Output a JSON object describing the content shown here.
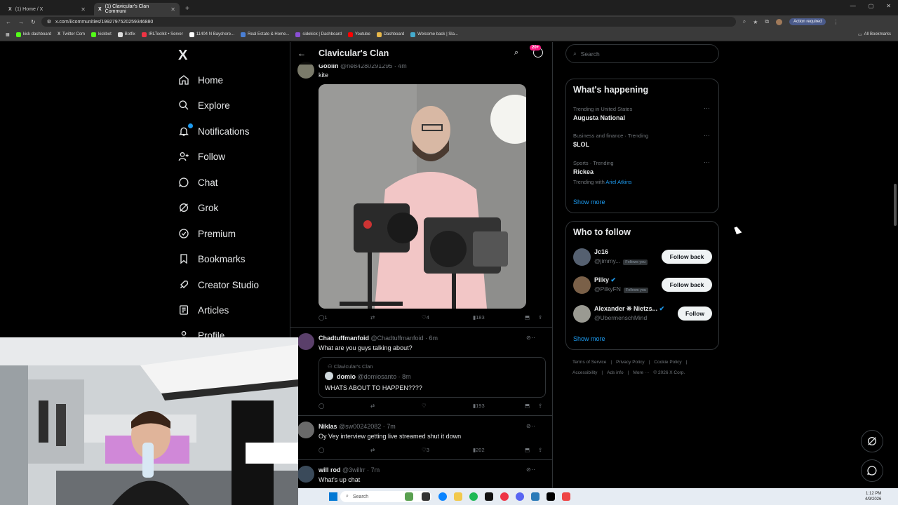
{
  "browser": {
    "tabs": [
      {
        "label": "(1) Home / X",
        "active": false
      },
      {
        "label": "(1) Clavicular's Clan Communi",
        "active": true
      }
    ],
    "url": "x.com/i/communities/1992797520259346880",
    "action_required": "Action required",
    "bookmarks": [
      "kick dashboard",
      "Twitter Com",
      "kickbot",
      "Botfix",
      "IRLToolkit • Server",
      "11404 N Bayshore...",
      "Real Estate & Home...",
      "sidekick | Dashboard",
      "Youtube",
      "Dashboard",
      "Welcome back | Sla..."
    ],
    "all_bookmarks": "All Bookmarks"
  },
  "nav": {
    "logo": "X",
    "items": [
      {
        "label": "Home",
        "icon": "home-icon"
      },
      {
        "label": "Explore",
        "icon": "search-icon"
      },
      {
        "label": "Notifications",
        "icon": "bell-icon"
      },
      {
        "label": "Follow",
        "icon": "follow-icon"
      },
      {
        "label": "Chat",
        "icon": "chat-icon"
      },
      {
        "label": "Grok",
        "icon": "grok-icon"
      },
      {
        "label": "Premium",
        "icon": "premium-icon"
      },
      {
        "label": "Bookmarks",
        "icon": "bookmark-icon"
      },
      {
        "label": "Creator Studio",
        "icon": "rocket-icon"
      },
      {
        "label": "Articles",
        "icon": "articles-icon"
      },
      {
        "label": "Profile",
        "icon": "profile-icon"
      }
    ]
  },
  "header": {
    "title": "Clavicular's Clan",
    "badge": "20+"
  },
  "posts": [
    {
      "name": "Goblin",
      "handle": "@ne84280291295 · 4m",
      "text": "kite",
      "reply": "1",
      "repost": "",
      "like": "4",
      "views": "183"
    },
    {
      "name": "Chadtuffmanfoid",
      "handle": "@Chadtuffmanfoid · 6m",
      "text": "What are you guys talking about?",
      "quote": {
        "community": "Clavicular's Clan",
        "name": "domio",
        "handle": "@domiosanto · 8m",
        "text": "WHATS ABOUT TO HAPPEN????"
      },
      "reply": "",
      "repost": "",
      "like": "",
      "views": "193"
    },
    {
      "name": "Niklas",
      "handle": "@sw00242082 · 7m",
      "text": "Oy Vey interview getting live streamed shut it down",
      "reply": "",
      "repost": "",
      "like": "3",
      "views": "202"
    },
    {
      "name": "will rod",
      "handle": "@3willrr · 7m",
      "text": "What's up chat"
    }
  ],
  "right": {
    "search_placeholder": "Search",
    "happening": {
      "title": "What's happening",
      "trends": [
        {
          "meta": "Trending in United States",
          "name": "Augusta National"
        },
        {
          "meta": "Business and finance · Trending",
          "name": "$LOL"
        },
        {
          "meta": "Sports · Trending",
          "name": "Rickea",
          "with_label": "Trending with",
          "with_name": "Ariel Atkins"
        }
      ],
      "show_more": "Show more"
    },
    "who_to_follow": {
      "title": "Who to follow",
      "users": [
        {
          "name": "Jc16",
          "handle": "@jimmy...",
          "follows_you": "Follows you",
          "button": "Follow back"
        },
        {
          "name": "Pilky",
          "handle": "@PilkyFN",
          "follows_you": "Follows you",
          "button": "Follow back"
        },
        {
          "name": "Alexander ❊ Nietzs...",
          "handle": "@UbermenschMind",
          "button": "Follow"
        }
      ],
      "show_more": "Show more"
    },
    "footer": [
      "Terms of Service",
      "|",
      "Privacy Policy",
      "|",
      "Cookie Policy",
      "|",
      "Accessibility",
      "|",
      "Ads info",
      "|",
      "More ···",
      "© 2026 X Corp."
    ]
  },
  "taskbar": {
    "search": "Search",
    "time": "1:12 PM",
    "date": "4/9/2026"
  },
  "colors": {
    "accent": "#1d9bf0",
    "badge": "#f91880",
    "border": "#2f3336"
  }
}
